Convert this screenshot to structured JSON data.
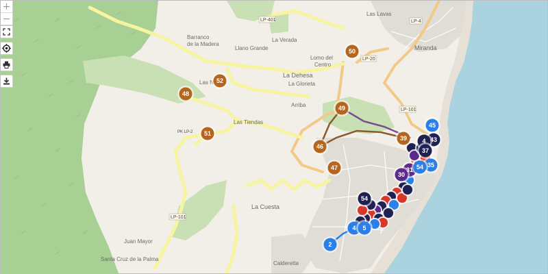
{
  "controls": {
    "zoom_in": "+",
    "zoom_out": "−",
    "fullscreen_icon": "fullscreen-icon",
    "locate_icon": "locate-icon",
    "print_icon": "print-icon",
    "download_icon": "download-icon"
  },
  "place_labels": {
    "barranco": "Barranco",
    "de_la_madera": "de la Madera",
    "llano_grande": "Llano Grande",
    "la_verada": "La Verada",
    "lomo_del_centro_1": "Lomo del",
    "lomo_del_centro_2": "Centro",
    "la_dehesa": "La Dehesa",
    "la_glorieta": "La Glorieta",
    "las_nieves": "Las Nieves",
    "las_tiendas": "Las Tiendas",
    "los_arriba": "Arriba",
    "la_cuesta": "La Cuesta",
    "juan_mayor": "Juan Mayor",
    "miranda": "Miranda",
    "las_lavas": "Las Lavas",
    "santa_cruz": "Santa Cruz de la Palma",
    "calderetta": "Calderetta"
  },
  "road_labels": {
    "lp401": "LP-401",
    "lp4": "LP-4",
    "lp20": "LP-20",
    "lp101_a": "LP-101",
    "lp101_b": "LP-101",
    "lp2": "PK LP-2"
  },
  "markers": [
    {
      "label": "50",
      "kind": "brown"
    },
    {
      "label": "52",
      "kind": "brown"
    },
    {
      "label": "48",
      "kind": "brown"
    },
    {
      "label": "49",
      "kind": "brown"
    },
    {
      "label": "51",
      "kind": "brown"
    },
    {
      "label": "46",
      "kind": "brown"
    },
    {
      "label": "47",
      "kind": "brown"
    },
    {
      "label": "39",
      "kind": "brown"
    },
    {
      "label": "45",
      "kind": "blue"
    },
    {
      "label": "43",
      "kind": "navy"
    },
    {
      "label": "4",
      "kind": "navy"
    },
    {
      "label": "37",
      "kind": "navy"
    },
    {
      "label": "35",
      "kind": "blue"
    },
    {
      "label": "31",
      "kind": "purple"
    },
    {
      "label": "30",
      "kind": "purple"
    },
    {
      "label": "54",
      "kind": "blue"
    },
    {
      "label": "54",
      "kind": "navy"
    },
    {
      "label": "4",
      "kind": "blue"
    },
    {
      "label": "5",
      "kind": "blue"
    },
    {
      "label": "2",
      "kind": "blue"
    }
  ],
  "colors": {
    "land": "#f2efe9",
    "forest": "#a8cf94",
    "park": "#c9e0b4",
    "sea": "#aad3df",
    "urban": "#e0dcd6",
    "road_yellow": "#f6f4a0",
    "road_orange": "#f3c987",
    "marker_brown": "#b5651d",
    "marker_navy": "#1f2152",
    "marker_blue": "#2a7fe8",
    "marker_purple": "#5b2a8a",
    "marker_red": "#d8382b"
  }
}
